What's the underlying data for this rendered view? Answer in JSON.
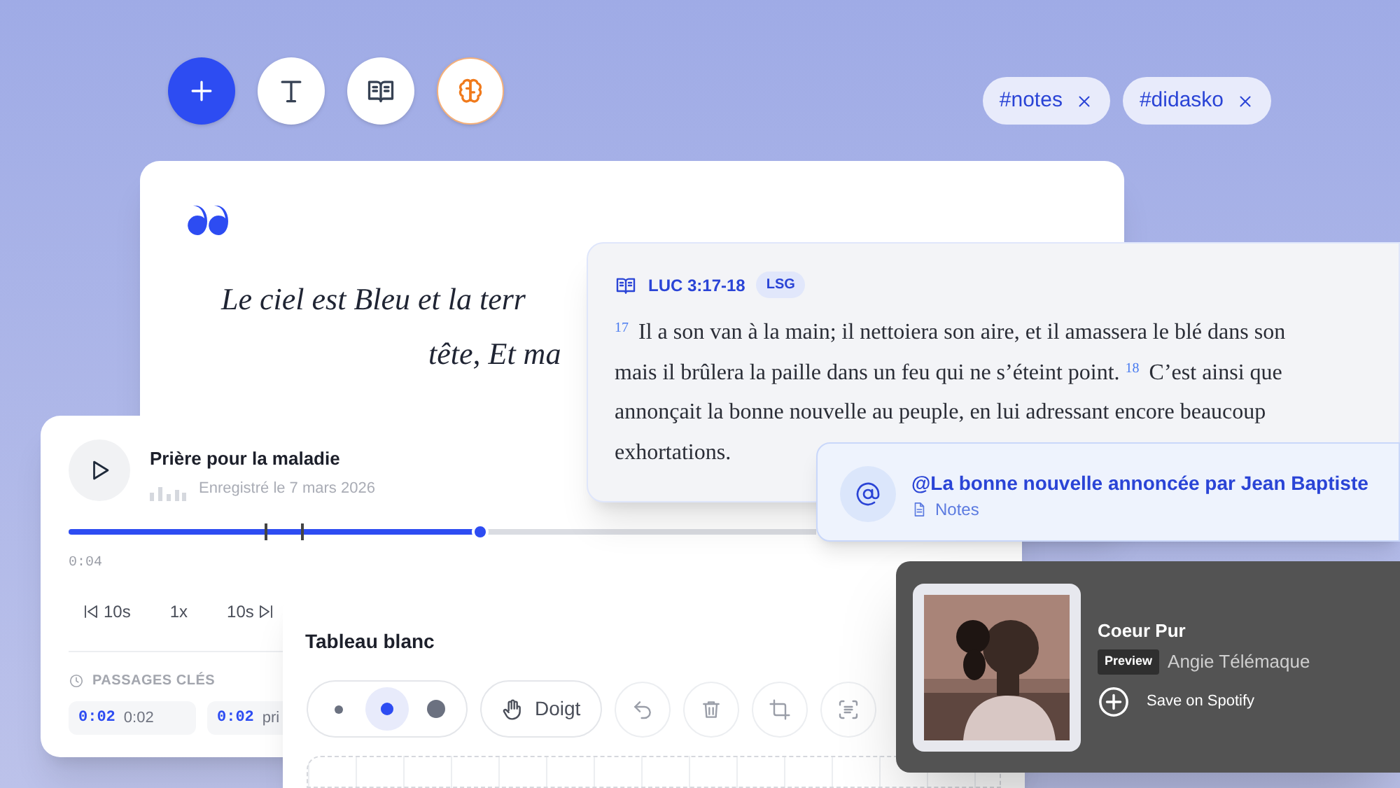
{
  "toolbar": [
    {
      "kind": "add"
    },
    {
      "kind": "text"
    },
    {
      "kind": "book"
    },
    {
      "kind": "brain"
    }
  ],
  "tags": [
    {
      "label": "#notes"
    },
    {
      "label": "#didasko"
    }
  ],
  "quote_card": {
    "lines": [
      "Le ciel est Bleu et la terr",
      "tête, Et ma"
    ]
  },
  "verse_card": {
    "reference": "LUC 3:17-18",
    "version": "LSG",
    "lines": [
      "$^{17}$ Il a son van à la main; il nettoiera son aire, et il amassera le blé dans son",
      "mais il brûlera la paille dans un feu qui ne s’éteint point. $^{18}$ C’est ainsi que",
      "annonçait la bonne nouvelle au peuple, en lui adressant encore beaucoup",
      "exhortations."
    ]
  },
  "mention": {
    "title": "@La bonne nouvelle annoncée par Jean Baptiste",
    "source": "Notes"
  },
  "audio": {
    "title": "Prière pour la maladie",
    "recorded": "Enregistré le 7 mars 2026",
    "level": 0.55,
    "elapsed": "0:04",
    "controls": [
      {
        "kind": "back",
        "label": "10s"
      },
      {
        "kind": "speed",
        "label": "1x"
      },
      {
        "kind": "forward",
        "label": "10s"
      }
    ],
    "passages_heading": "PASSAGES CLÉS",
    "passages": [
      {
        "time": "0:02",
        "label": "0:02"
      },
      {
        "time": "0:02",
        "label": "pri"
      }
    ]
  },
  "whiteboard": {
    "title": "Tableau blanc",
    "sizes": [
      {
        "kind": "small",
        "selected": false
      },
      {
        "kind": "medium",
        "selected": true
      },
      {
        "kind": "large",
        "selected": false
      }
    ],
    "mode": "Doigt",
    "tools": [
      {
        "kind": "undo"
      },
      {
        "kind": "trash"
      },
      {
        "kind": "crop"
      },
      {
        "kind": "scan"
      }
    ]
  },
  "player": {
    "title": "Coeur Pur",
    "badge": "Preview",
    "artist": "Angie Télémaque",
    "action": "Save on Spotify"
  }
}
